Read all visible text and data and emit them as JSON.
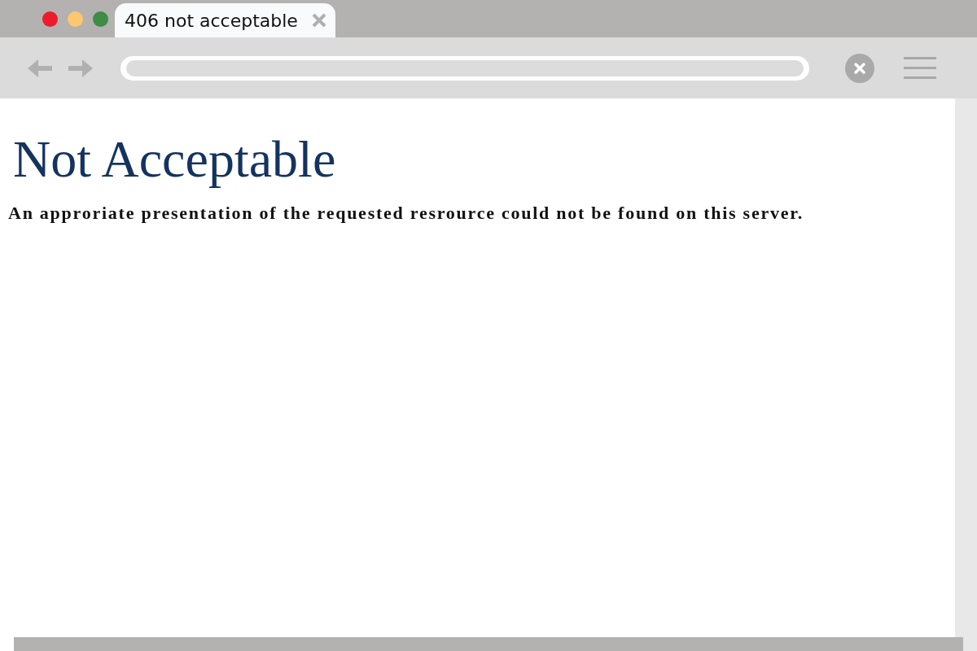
{
  "tab": {
    "title": "406 not acceptable",
    "selected": true
  },
  "page": {
    "heading": "Not Acceptable",
    "message": "An approriate presentation of the requested resrource could not be found on this server."
  }
}
